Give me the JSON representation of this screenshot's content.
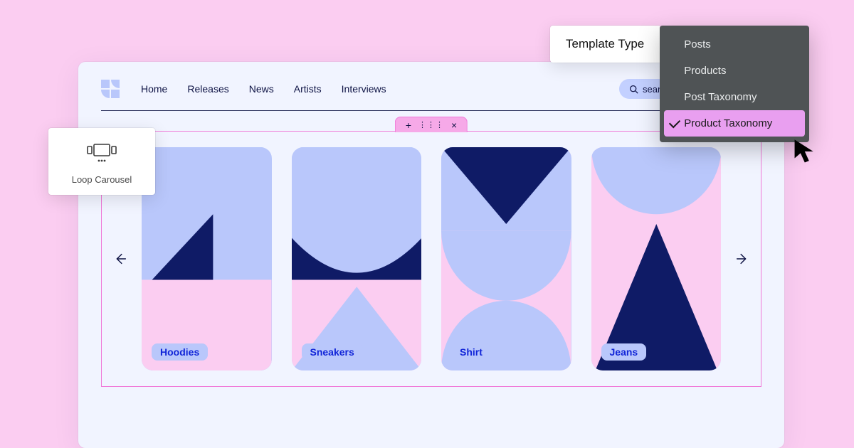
{
  "nav": {
    "items": [
      "Home",
      "Releases",
      "News",
      "Artists",
      "Interviews"
    ]
  },
  "search": {
    "placeholder": "search"
  },
  "widget": {
    "label": "Loop Carousel"
  },
  "handle": {
    "plus": "+",
    "close": "×"
  },
  "cards": [
    {
      "label": "Hoodies"
    },
    {
      "label": "Sneakers"
    },
    {
      "label": "Shirt"
    },
    {
      "label": "Jeans"
    }
  ],
  "template": {
    "title": "Template Type",
    "options": [
      "Posts",
      "Products",
      "Post Taxonomy",
      "Product Taxonomy"
    ],
    "selected_index": 3
  },
  "colors": {
    "page_bg": "#fbcdf1",
    "window_bg": "#f1f4ff",
    "pale_blue": "#b9c7fb",
    "navy": "#0f1b66",
    "pink": "#fbcdf1",
    "accent_pink": "#f079d8",
    "menu_bg": "#4f5355",
    "menu_sel": "#e99ff0",
    "pill_text": "#1226d8"
  }
}
